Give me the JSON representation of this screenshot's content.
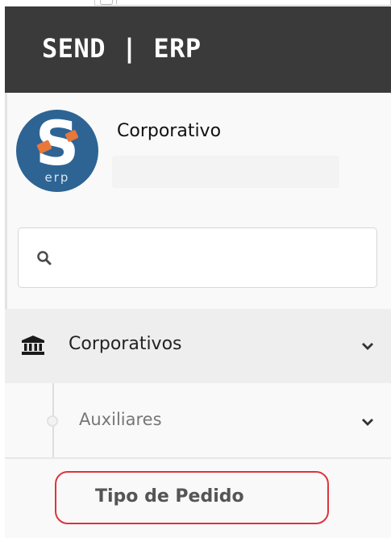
{
  "header": {
    "brand": "SEND | ERP"
  },
  "profile": {
    "avatar_text": "S",
    "avatar_subtext": "erp",
    "company_name": "Corporativo"
  },
  "search": {
    "value": "",
    "placeholder": ""
  },
  "menu": {
    "items": [
      {
        "label": "Corporativos",
        "icon": "bank-icon",
        "expanded": true,
        "children": [
          {
            "label": "Auxiliares",
            "expanded": true,
            "children": [
              {
                "label": "Tipo de Pedido",
                "highlighted": true
              }
            ]
          }
        ]
      }
    ]
  },
  "colors": {
    "header_bg": "#3a3a3a",
    "avatar_bg": "#2d6494",
    "avatar_accent": "#e8773a",
    "highlight_border": "#e0333c"
  }
}
